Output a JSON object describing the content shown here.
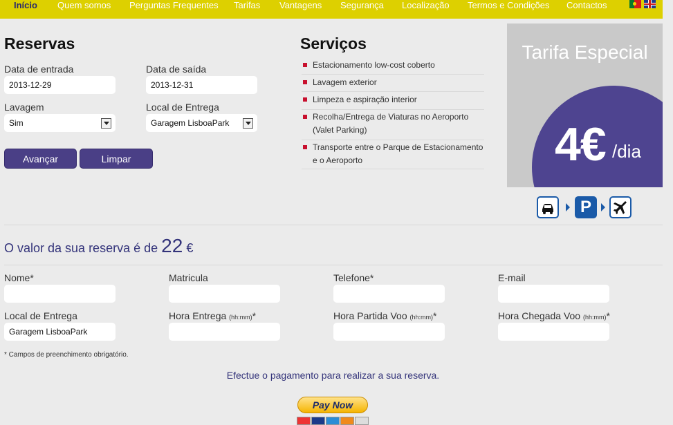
{
  "nav": {
    "items": [
      "Início",
      "Quem somos",
      "Perguntas Frequentes",
      "Tarifas",
      "Vantagens",
      "Segurança",
      "Localização",
      "Termos e Condições",
      "Contactos"
    ]
  },
  "reservas": {
    "title": "Reservas",
    "entrada_label": "Data de entrada",
    "entrada_value": "2013-12-29",
    "saida_label": "Data de saída",
    "saida_value": "2013-12-31",
    "lavagem_label": "Lavagem",
    "lavagem_value": "Sim",
    "entrega_label": "Local de Entrega",
    "entrega_value": "Garagem LisboaPark",
    "avancar": "Avançar",
    "limpar": "Limpar"
  },
  "servicos": {
    "title": "Serviços",
    "items": [
      "Estacionamento low-cost coberto",
      "Lavagem exterior",
      "Limpeza e aspiração interior",
      "Recolha/Entrega de Viaturas no Aeroporto (Valet Parking)",
      "Transporte entre o Parque de Estacionamento e o Aeroporto"
    ]
  },
  "promo": {
    "title": "Tarifa Especial",
    "price": "4€",
    "unit": "/dia",
    "icons": [
      "car-icon",
      "parking-icon",
      "plane-icon"
    ]
  },
  "total": {
    "text": "O valor da sua reserva é de",
    "amount": "22",
    "currency": "€"
  },
  "form": {
    "nome": "Nome*",
    "matricula": "Matricula",
    "telefone": "Telefone*",
    "email": "E-mail",
    "local": "Local de Entrega",
    "local_value": "Garagem LisboaPark",
    "hora_entrega": "Hora Entrega",
    "hora_partida": "Hora Partida Voo",
    "hora_chegada": "Hora Chegada Voo",
    "hint": "(hh:mm)",
    "star": "*",
    "note": "* Campos de preenchimento obrigatório."
  },
  "payment": {
    "text": "Efectue o pagamento para realizar a sua reserva.",
    "button": "Pay Now",
    "cards": [
      "MasterCard",
      "VISA",
      "AMEX",
      "DISCOVER",
      "BANK"
    ]
  },
  "colors": {
    "nav_bg": "#ddd000",
    "accent": "#4a3f86",
    "promo_circle": "#4e4490",
    "bullet": "#c8102e"
  }
}
